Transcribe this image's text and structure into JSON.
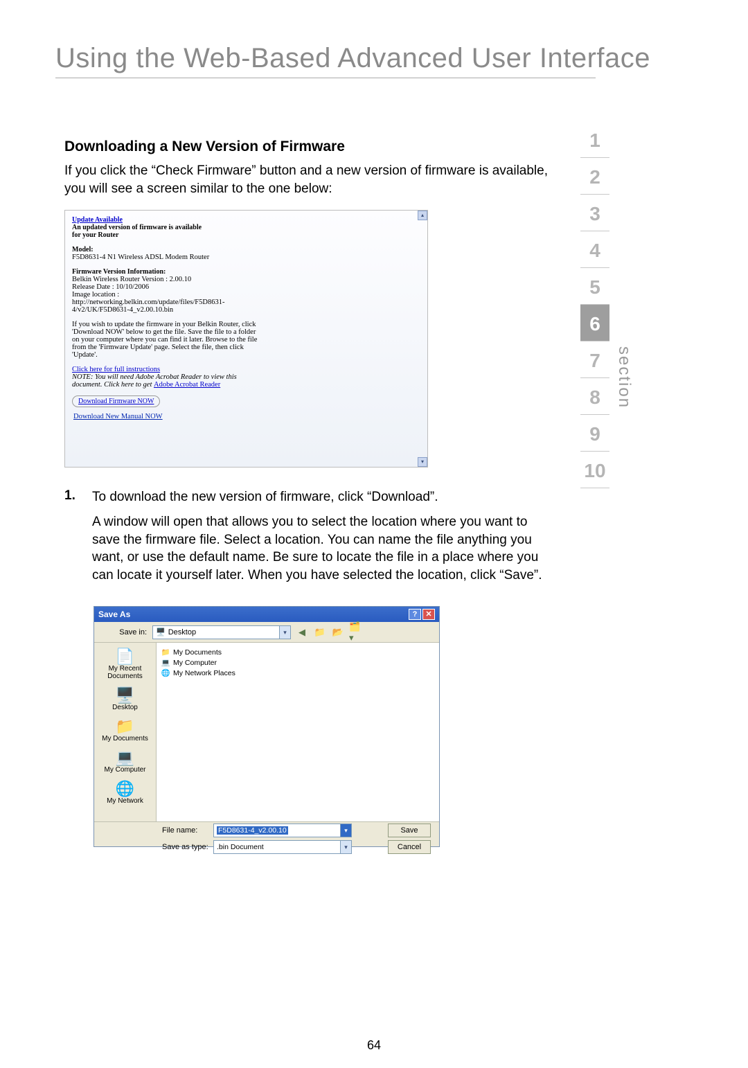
{
  "page": {
    "title": "Using the Web-Based Advanced User Interface",
    "number": "64",
    "section_label": "section"
  },
  "nav": {
    "items": [
      "1",
      "2",
      "3",
      "4",
      "5",
      "6",
      "7",
      "8",
      "9",
      "10"
    ],
    "active_index": 5
  },
  "content": {
    "sub_heading": "Downloading a New Version of Firmware",
    "intro": "If you click the “Check Firmware” button and a new version of firmware is available, you will see a screen similar to the one below:",
    "step1_num": "1.",
    "step1_text": "To download the new version of firmware, click “Download”.",
    "step1_cont": "A window will open that allows you to select the location where you want to save the firmware file. Select a location. You can name the file anything you want, or use the default name. Be sure to locate the file in a place where you can locate it yourself later. When you have selected the location, click “Save”."
  },
  "firmware_box": {
    "update_title": "Update Available",
    "update_sub1": "An updated version of firmware is available",
    "update_sub2": "for your Router",
    "model_label": "Model:",
    "model_value": "F5D8631-4 N1 Wireless ADSL Modem Router",
    "ver_label": "Firmware Version Information:",
    "ver_line1": "Belkin Wireless Router Version : 2.00.10",
    "ver_line2": "Release Date : 10/10/2006",
    "ver_line3": "Image location :",
    "ver_line4": "http://networking.belkin.com/update/files/F5D8631-4/v2/UK/F5D8631-4_v2.00.10.bin",
    "instr": "If you wish to update the firmware in your Belkin Router, click 'Download NOW' below to get the file. Save the file to a folder on your computer where you can find it later. Browse to the file from the 'Firmware Update' page. Select the file, then click 'Update'.",
    "instr_link": "Click here for full instructions",
    "note1": "NOTE: You will need Adobe Acrobat Reader to view this document.",
    "note2_prefix": " Click here to get ",
    "note2_link": "Adobe Acrobat Reader",
    "dl_btn": "Download Firmware NOW",
    "dl_manual": "Download New Manual NOW"
  },
  "saveas": {
    "title": "Save As",
    "savein_label": "Save in:",
    "savein_value": "Desktop",
    "places": [
      "My Recent Documents",
      "Desktop",
      "My Documents",
      "My Computer",
      "My Network"
    ],
    "listing": [
      "My Documents",
      "My Computer",
      "My Network Places"
    ],
    "filename_label": "File name:",
    "filename_value": "F5D8631-4_v2.00.10",
    "savetype_label": "Save as type:",
    "savetype_value": ".bin Document",
    "save_btn": "Save",
    "cancel_btn": "Cancel"
  }
}
